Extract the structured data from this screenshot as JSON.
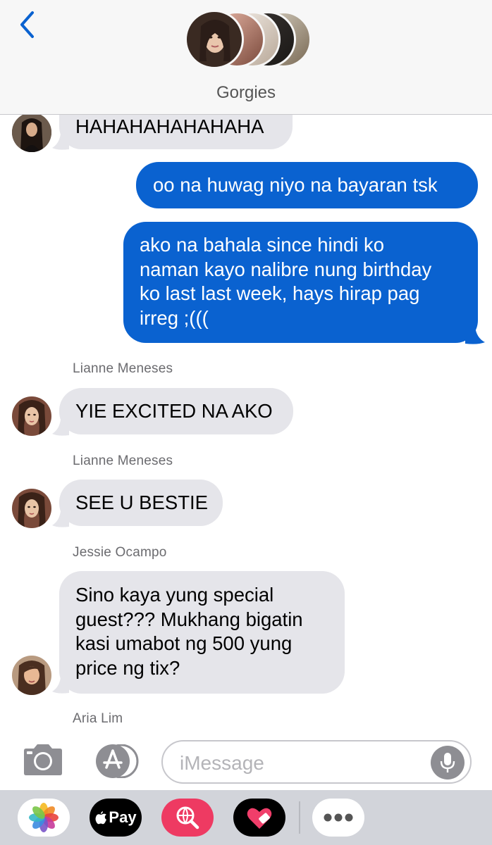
{
  "header": {
    "group_name": "Gorgies"
  },
  "messages": [
    {
      "kind": "incoming",
      "text": "HAHAHAHAHAHAHA"
    },
    {
      "kind": "outgoing",
      "text": "oo na huwag niyo na bayaran tsk"
    },
    {
      "kind": "outgoing",
      "lines": [
        "ako na bahala since hindi ko",
        "naman kayo nalibre nung birthday",
        "ko last last week, hays hirap pag",
        "irreg ;((("
      ]
    },
    {
      "kind": "incoming",
      "sender": "Lianne Meneses",
      "text": "YIE EXCITED NA AKO"
    },
    {
      "kind": "incoming",
      "sender": "Lianne Meneses",
      "text": "SEE U BESTIE"
    },
    {
      "kind": "incoming",
      "sender": "Jessie Ocampo",
      "lines": [
        "Sino kaya yung special",
        "guest??? Mukhang bigatin",
        "kasi umabot ng 500 yung",
        "price ng tix?"
      ]
    },
    {
      "kind": "incoming",
      "sender": "Aria Lim"
    }
  ],
  "input": {
    "placeholder": "iMessage"
  },
  "apps": {
    "apple_pay_label": "Pay"
  },
  "colors": {
    "outgoing_bubble": "#0a62d0",
    "incoming_bubble": "#e5e5ea",
    "accent": "#0a62d0"
  }
}
